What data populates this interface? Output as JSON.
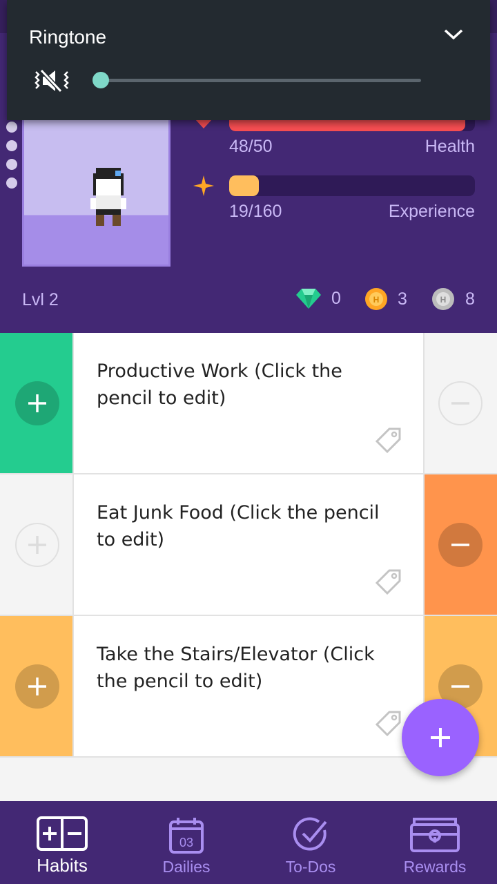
{
  "ringtone": {
    "title": "Ringtone",
    "volume_fraction": 0.0
  },
  "stats": {
    "health": {
      "value": "48/50",
      "label": "Health",
      "fraction": 0.96,
      "color": "#f74e52"
    },
    "experience": {
      "value": "19/160",
      "label": "Experience",
      "fraction": 0.12,
      "color": "#ffbe5d"
    }
  },
  "level": "Lvl 2",
  "currency": {
    "gems": "0",
    "gold": "3",
    "silver": "8"
  },
  "habits": [
    {
      "text": "Productive Work (Click the pencil to edit)",
      "plus_active": true,
      "minus_active": false,
      "color": "#24cc8f"
    },
    {
      "text": "Eat Junk Food (Click the pencil to edit)",
      "plus_active": false,
      "minus_active": true,
      "color": "#ff944c"
    },
    {
      "text": "Take the Stairs/Elevator (Click the pencil to edit)",
      "plus_active": true,
      "minus_active": true,
      "color": "#ffbe5d"
    }
  ],
  "nav": {
    "habits": "Habits",
    "dailies": "Dailies",
    "dailies_date": "03",
    "todos": "To-Dos",
    "rewards": "Rewards"
  },
  "colors": {
    "header": "#432874",
    "fab": "#9a62ff"
  }
}
